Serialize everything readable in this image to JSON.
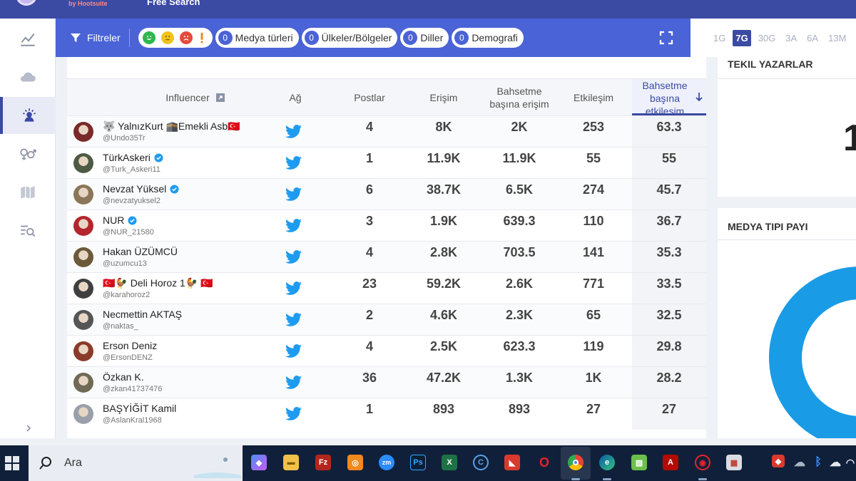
{
  "app": {
    "byline": "by Hootsuite",
    "title": "Free Search"
  },
  "filters": {
    "label": "Filtreler",
    "pills": [
      {
        "count": "0",
        "label": "Medya türleri"
      },
      {
        "count": "0",
        "label": "Ülkeler/Bölgeler"
      },
      {
        "count": "0",
        "label": "Diller"
      },
      {
        "count": "0",
        "label": "Demografi"
      }
    ]
  },
  "ranges": [
    "1G",
    "7G",
    "30G",
    "3A",
    "6A",
    "13M"
  ],
  "active_range": "7G",
  "table": {
    "headers": {
      "influencer": "Influencer",
      "network": "Ağ",
      "posts": "Postlar",
      "reach": "Erişim",
      "reach_per_mention": "Bahsetme başına erişim",
      "engagement": "Etkileşim",
      "engagement_per_mention": "Bahsetme başına etkileşim"
    },
    "rows": [
      {
        "name": "🐺 YalnızKurt 🕋Emekli Asb🇹🇷",
        "handle": "@Undo35Tr",
        "verified": false,
        "posts": "4",
        "reach": "8K",
        "rpm": "2K",
        "eng": "253",
        "epm": "63.3",
        "avatar": "#7a2a2a"
      },
      {
        "name": "TürkAskeri",
        "handle": "@Turk_Askeri11",
        "verified": true,
        "posts": "1",
        "reach": "11.9K",
        "rpm": "11.9K",
        "eng": "55",
        "epm": "55",
        "avatar": "#4d5a44"
      },
      {
        "name": "Nevzat Yüksel",
        "handle": "@nevzatyuksel2",
        "verified": true,
        "posts": "6",
        "reach": "38.7K",
        "rpm": "6.5K",
        "eng": "274",
        "epm": "45.7",
        "avatar": "#8a7658"
      },
      {
        "name": "NUR",
        "handle": "@NUR_21580",
        "verified": true,
        "posts": "3",
        "reach": "1.9K",
        "rpm": "639.3",
        "eng": "110",
        "epm": "36.7",
        "avatar": "#b3262d"
      },
      {
        "name": "Hakan ÜZÜMCÜ",
        "handle": "@uzumcu13",
        "verified": false,
        "posts": "4",
        "reach": "2.8K",
        "rpm": "703.5",
        "eng": "141",
        "epm": "35.3",
        "avatar": "#6b5a3a"
      },
      {
        "name": "🇹🇷🐓 Deli Horoz 1🐓 🇹🇷",
        "handle": "@karahoroz2",
        "verified": false,
        "posts": "23",
        "reach": "59.2K",
        "rpm": "2.6K",
        "eng": "771",
        "epm": "33.5",
        "avatar": "#3f3f3f"
      },
      {
        "name": "Necmettin AKTAŞ",
        "handle": "@naktas_",
        "verified": false,
        "posts": "2",
        "reach": "4.6K",
        "rpm": "2.3K",
        "eng": "65",
        "epm": "32.5",
        "avatar": "#555555"
      },
      {
        "name": "Erson Deniz",
        "handle": "@ErsonDENZ",
        "verified": false,
        "posts": "4",
        "reach": "2.5K",
        "rpm": "623.3",
        "eng": "119",
        "epm": "29.8",
        "avatar": "#8a3b2a"
      },
      {
        "name": "Özkan K.",
        "handle": "@zkan41737476",
        "verified": false,
        "posts": "36",
        "reach": "47.2K",
        "rpm": "1.3K",
        "eng": "1K",
        "epm": "28.2",
        "avatar": "#6f6a55"
      },
      {
        "name": "BAŞYİĞİT Kamil",
        "handle": "@AslanKral1968",
        "verified": false,
        "posts": "1",
        "reach": "893",
        "rpm": "893",
        "eng": "27",
        "epm": "27",
        "avatar": "#9aa0aa"
      }
    ]
  },
  "right": {
    "unique_authors_title": "TEKIL YAZARLAR",
    "unique_authors_value": "1",
    "media_type_title": "MEDYA TIPI PAYI"
  },
  "taskbar": {
    "search_label": "Ara"
  },
  "colors": {
    "brand": "#3b4aa3",
    "filterbar": "#4a63d6",
    "twitter": "#1d9bf0",
    "donut": "#1a9be6"
  }
}
